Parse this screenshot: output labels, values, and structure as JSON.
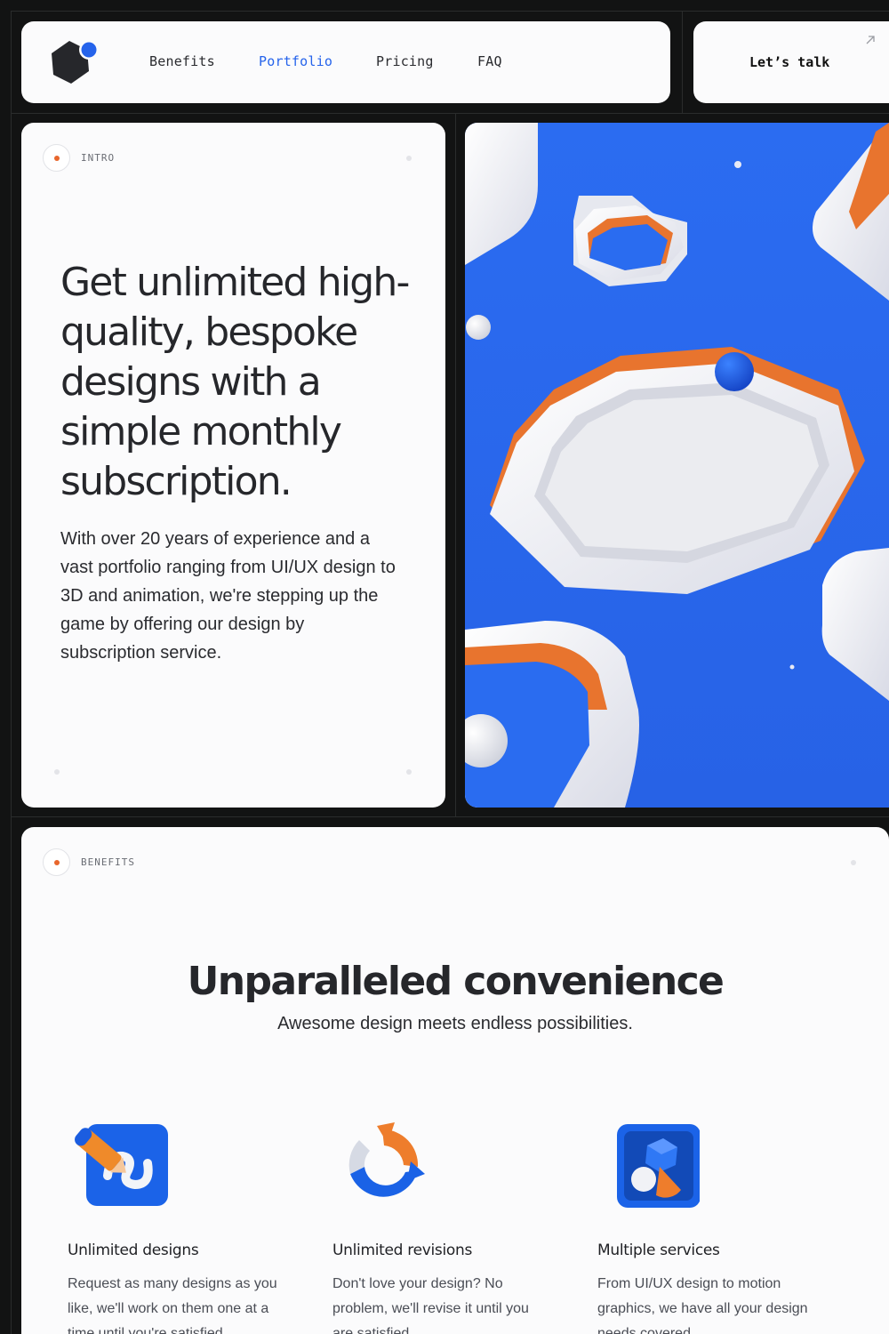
{
  "nav": {
    "links": [
      "Benefits",
      "Portfolio",
      "Pricing",
      "FAQ"
    ],
    "active": "Portfolio",
    "cta_label": "Let’s talk"
  },
  "intro": {
    "tag": "INTRO",
    "title": "Get unlimited high-quality, bespoke designs with a simple monthly subscription.",
    "body": "With over 20 years of experience and a vast portfolio ranging from UI/UX design to 3D and animation, we're stepping up the game by offering our design by subscription service."
  },
  "benefits": {
    "tag": "BENEFITS",
    "title": "Unparalleled convenience",
    "subtitle": "Awesome design meets endless possibilities.",
    "features": [
      {
        "icon": "pencil-app-icon",
        "title": "Unlimited designs",
        "desc": "Request as many designs as you like, we'll work on them one at a time until you're satisfied."
      },
      {
        "icon": "refresh-arrows-icon",
        "title": "Unlimited revisions",
        "desc": "Don't love your design? No problem, we'll revise it until you are satisfied."
      },
      {
        "icon": "shapes-app-icon",
        "title": "Multiple services",
        "desc": "From UI/UX design to motion graphics, we have all your design needs covered."
      }
    ]
  },
  "colors": {
    "accent": "#2563eb",
    "tag_dot": "#e8662c",
    "background": "#121313",
    "card": "#fbfbfc",
    "illustration_blue": "#2a6cf0",
    "illustration_orange": "#e8742e"
  }
}
